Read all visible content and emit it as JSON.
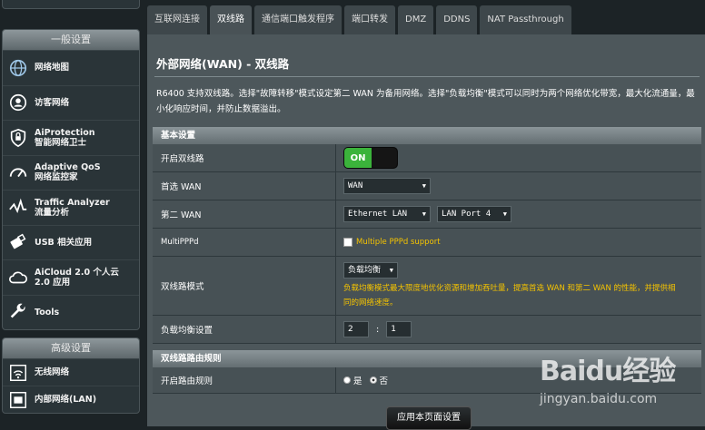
{
  "sidebar": {
    "general_title": "一般设置",
    "items": [
      {
        "icon": "globe-icon",
        "line1": "网络地图",
        "line2": ""
      },
      {
        "icon": "guest-network-icon",
        "line1": "访客网络",
        "line2": ""
      },
      {
        "icon": "shield-icon",
        "line1": "AiProtection",
        "line2": "智能网络卫士"
      },
      {
        "icon": "speedometer-icon",
        "line1": "Adaptive QoS",
        "line2": "网络监控家"
      },
      {
        "icon": "traffic-analyzer-icon",
        "line1": "Traffic Analyzer",
        "line2": "流量分析"
      },
      {
        "icon": "usb-icon",
        "line1": "USB 相关应用",
        "line2": ""
      },
      {
        "icon": "cloud-icon",
        "line1": "AiCloud 2.0 个人云",
        "line2": "2.0 应用"
      },
      {
        "icon": "wrench-icon",
        "line1": "Tools",
        "line2": ""
      }
    ],
    "advanced_title": "高级设置",
    "advanced_items": [
      {
        "icon": "wifi-icon",
        "line1": "无线网络"
      },
      {
        "icon": "lan-icon",
        "line1": "内部网络(LAN)"
      }
    ]
  },
  "tabs": [
    "互联网连接",
    "双线路",
    "通信端口触发程序",
    "端口转发",
    "DMZ",
    "DDNS",
    "NAT Passthrough"
  ],
  "active_tab": 1,
  "page": {
    "title": "外部网络(WAN) - 双线路",
    "description": "R6400 支持双线路。选择\"故障转移\"模式设定第二 WAN 为备用网络。选择\"负载均衡\"模式可以同时为两个网络优化带宽，最大化流通量，最小化响应时间，并防止数据溢出。"
  },
  "basic": {
    "header": "基本设置",
    "dual_wan_label": "开启双线路",
    "toggle_on": "ON",
    "primary_wan_label": "首选 WAN",
    "primary_wan_value": "WAN",
    "secondary_wan_label": "第二 WAN",
    "secondary_wan_value": "Ethernet LAN",
    "secondary_port_value": "LAN Port 4",
    "multipppd_label": "MultiPPPd",
    "multipppd_checkbox": "Multiple PPPd support",
    "mode_label": "双线路模式",
    "mode_value": "负载均衡",
    "mode_hint": "负载均衡模式最大限度地优化资源和增加吞吐量，提高首选 WAN 和第二 WAN 的性能，并提供相同的网络速度。",
    "ratio_label": "负载均衡设置",
    "ratio_a": "2",
    "ratio_sep": ":",
    "ratio_b": "1"
  },
  "routing": {
    "header": "双线路路由规则",
    "enable_label": "开启路由规则",
    "yes": "是",
    "no": "否",
    "selected": "否"
  },
  "apply_button": "应用本页面设置",
  "watermark": {
    "logo": "Baidu经验",
    "sub": "jingyan.baidu.com"
  },
  "colors": {
    "toggle_on": "#3bb33b",
    "hint": "#f5c300",
    "background": "#1c2326"
  }
}
